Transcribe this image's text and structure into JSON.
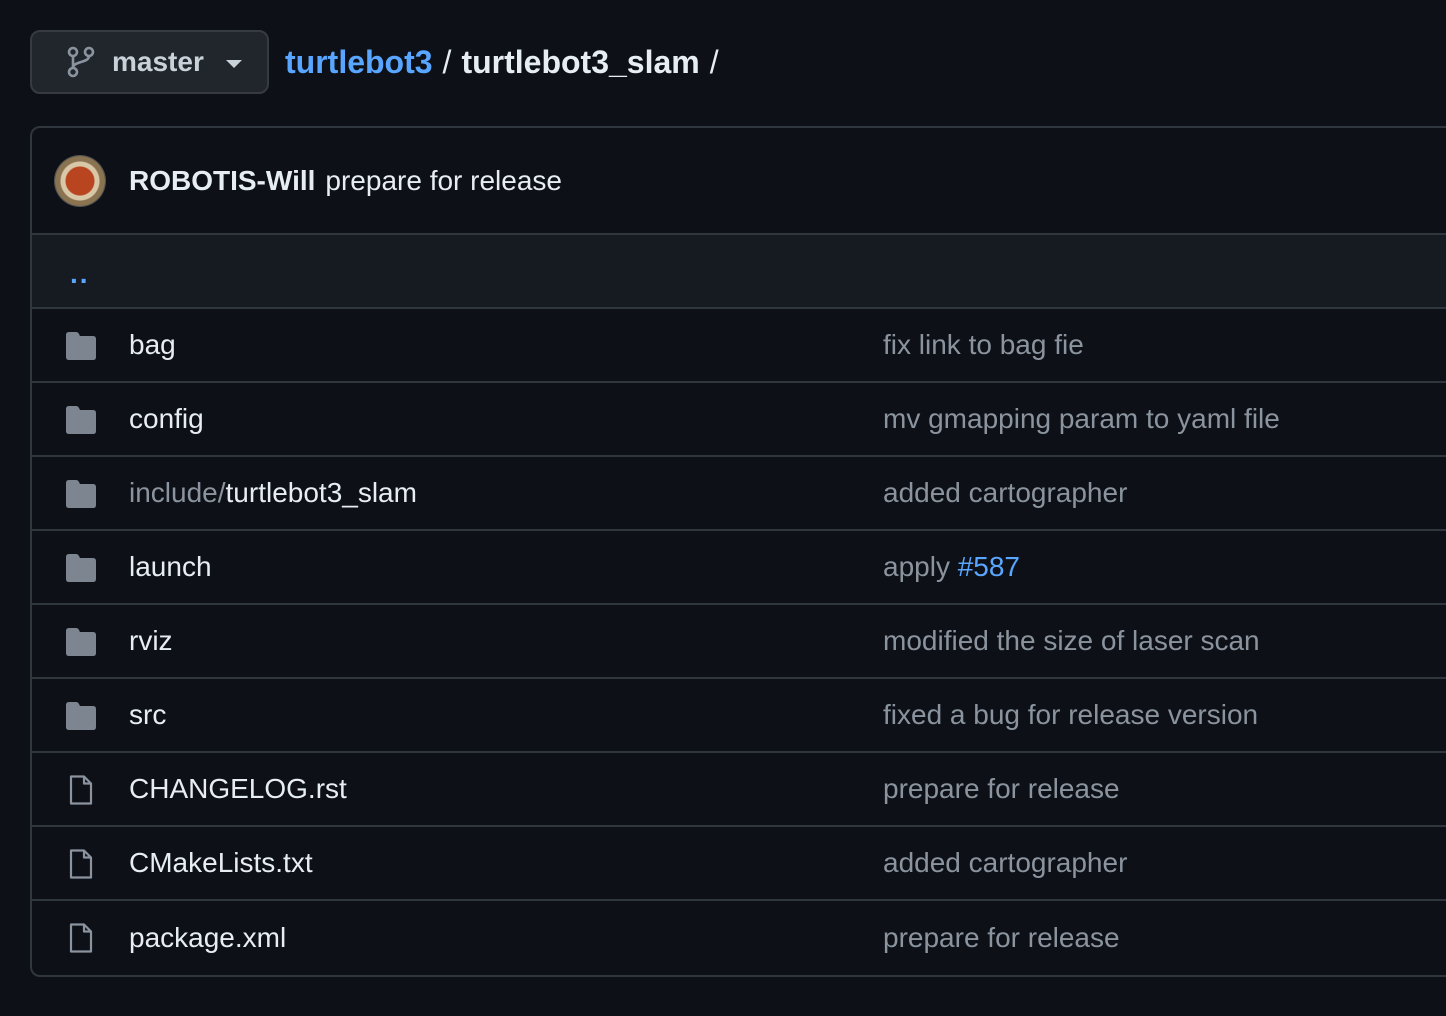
{
  "branch": {
    "label": "master"
  },
  "breadcrumb": {
    "repo": "turtlebot3",
    "separator": "/",
    "current": "turtlebot3_slam",
    "trailing_separator": "/"
  },
  "latest_commit": {
    "author": "ROBOTIS-Will",
    "message": "prepare for release"
  },
  "parent_dir": {
    "label": ".."
  },
  "files": [
    {
      "type": "folder",
      "name": "bag",
      "commit": "fix link to bag fie"
    },
    {
      "type": "folder",
      "name": "config",
      "commit": "mv gmapping param to yaml file"
    },
    {
      "type": "folder",
      "name_prefix": "include/",
      "name": "turtlebot3_slam",
      "commit": "added cartographer"
    },
    {
      "type": "folder",
      "name": "launch",
      "commit": "apply ",
      "commit_link": "#587"
    },
    {
      "type": "folder",
      "name": "rviz",
      "commit": "modified the size of laser scan"
    },
    {
      "type": "folder",
      "name": "src",
      "commit": "fixed a bug for release version"
    },
    {
      "type": "file",
      "name": "CHANGELOG.rst",
      "commit": "prepare for release"
    },
    {
      "type": "file",
      "name": "CMakeLists.txt",
      "commit": "added cartographer"
    },
    {
      "type": "file",
      "name": "package.xml",
      "commit": "prepare for release"
    }
  ],
  "colors": {
    "background": "#0d1117",
    "link": "#58a6ff",
    "muted_text": "#8b949e",
    "border": "#30363d",
    "folder_icon": "#7d8590"
  }
}
